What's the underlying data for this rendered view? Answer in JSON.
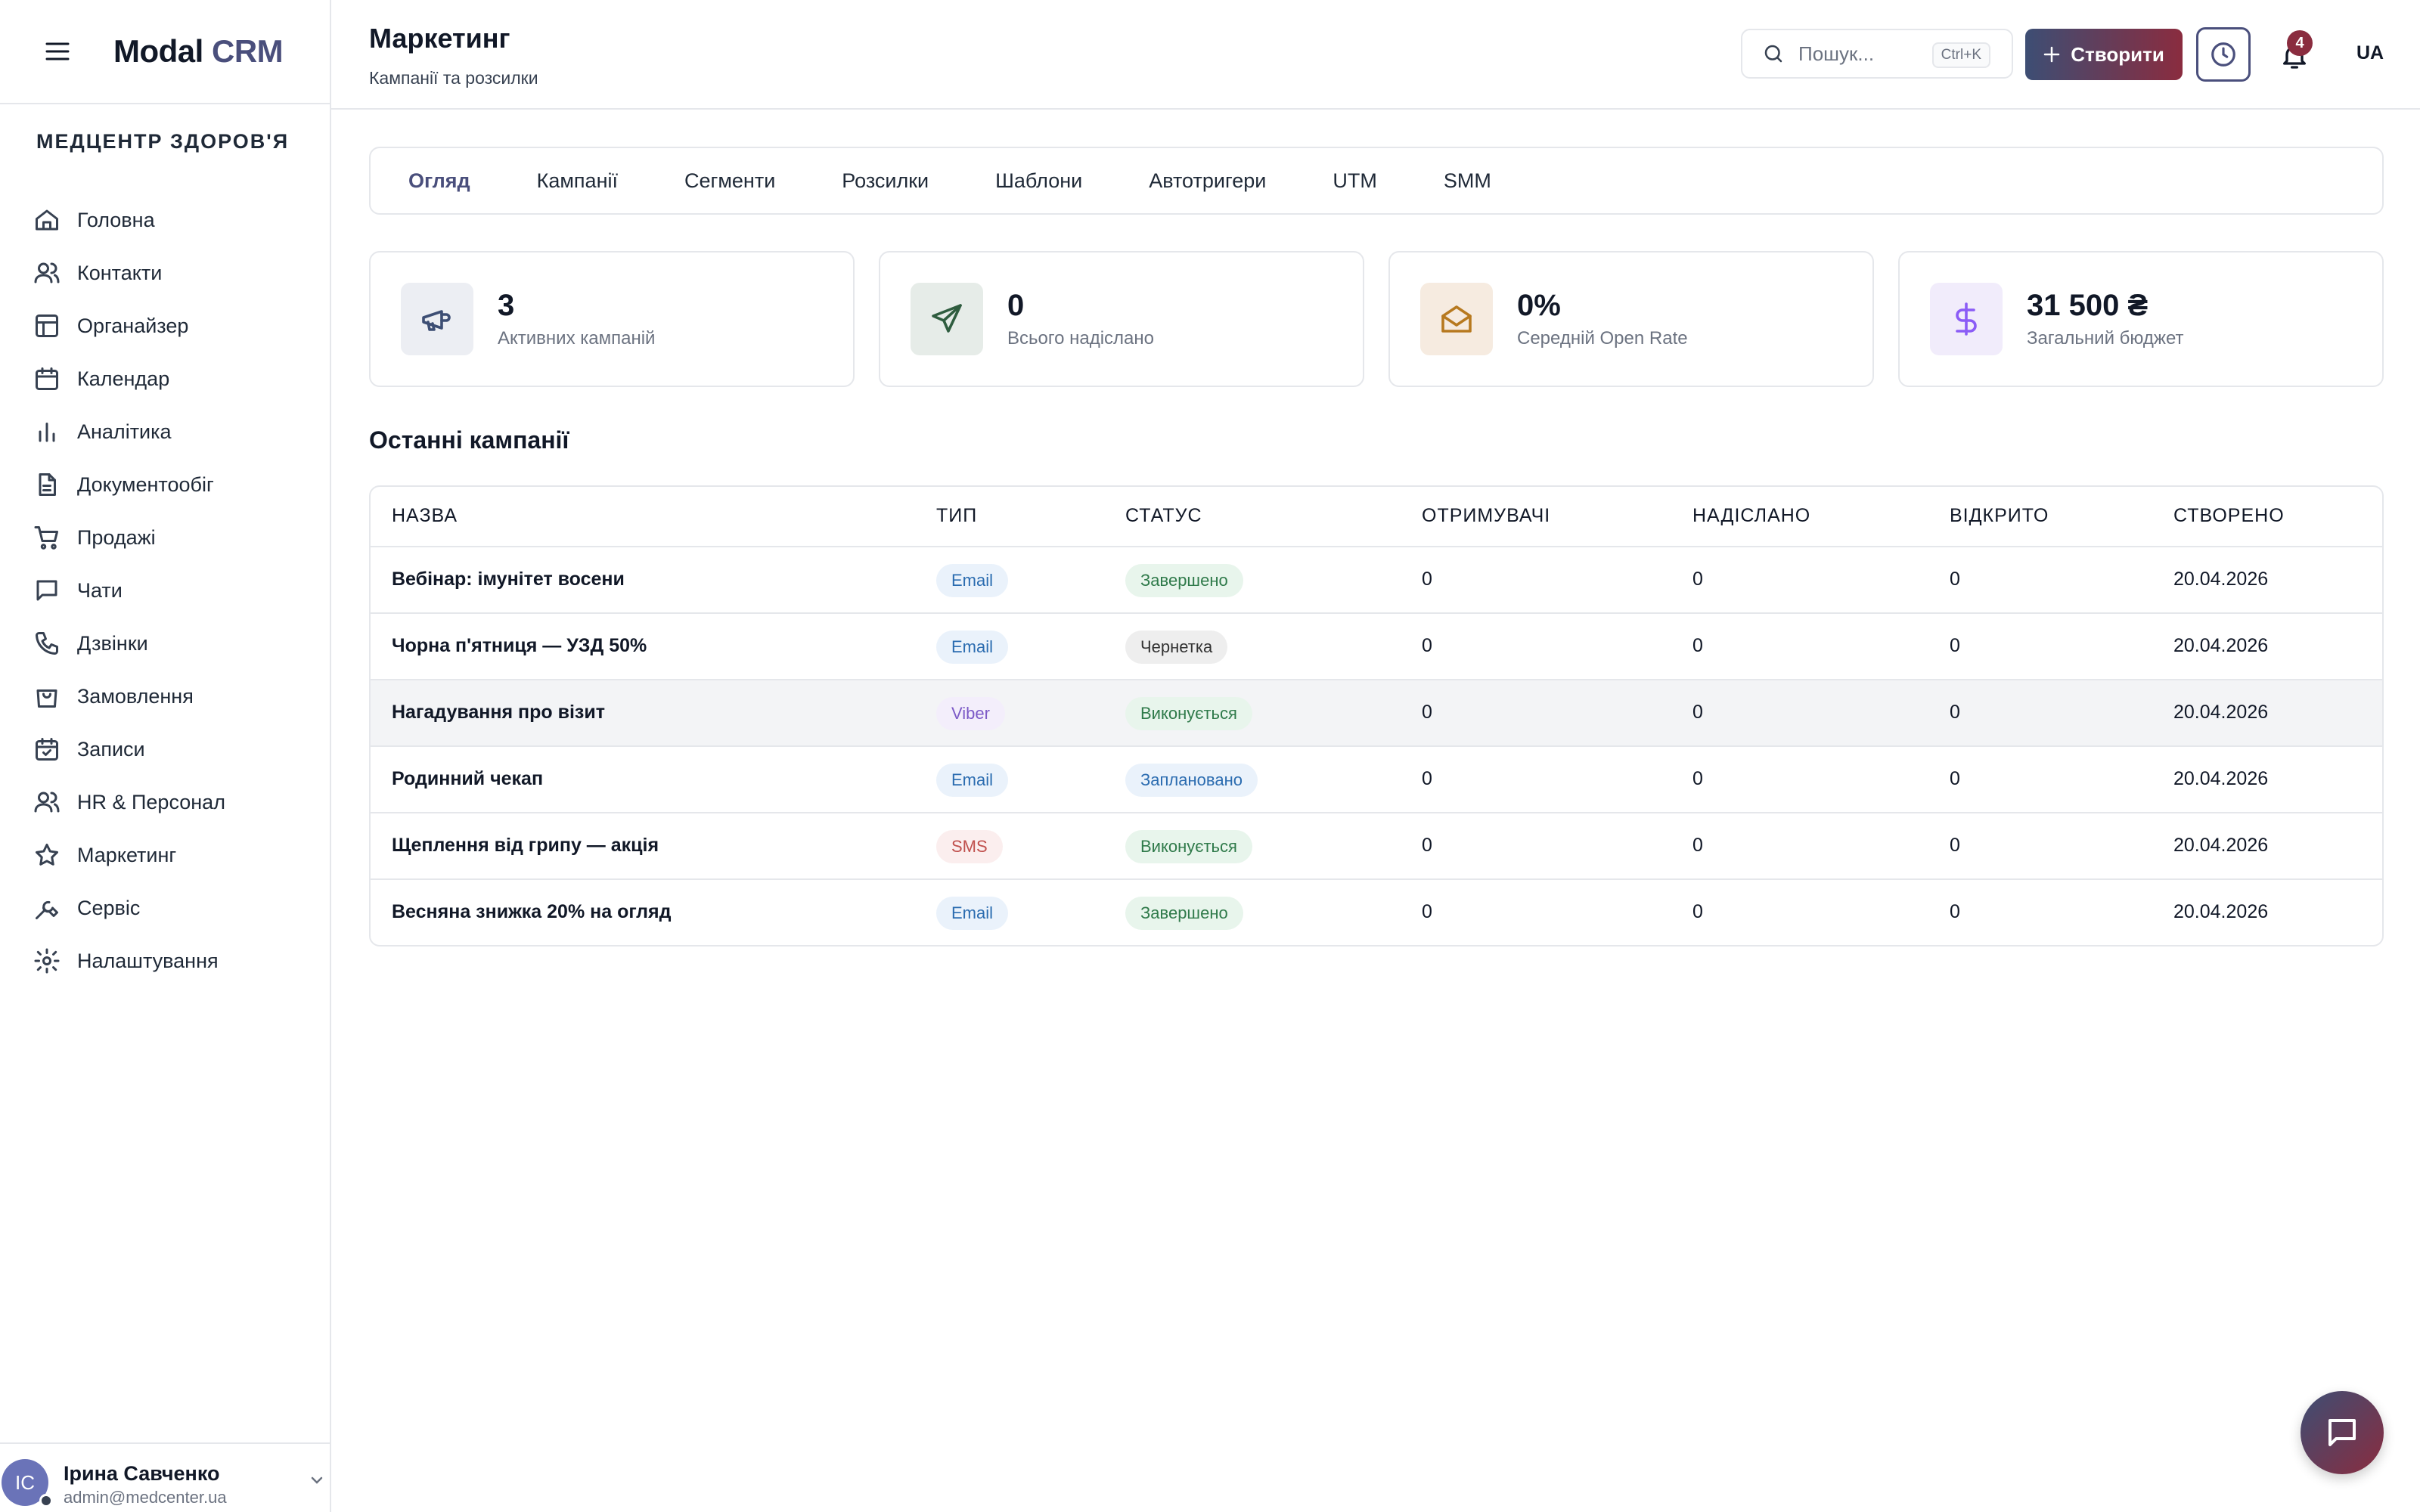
{
  "app": {
    "logo_main": "Modal",
    "logo_accent": "CRM",
    "org_name": "МЕДЦЕНТР ЗДОРОВ'Я"
  },
  "sidebar": {
    "items": [
      {
        "label": "Головна",
        "icon": "home-icon"
      },
      {
        "label": "Контакти",
        "icon": "users-icon"
      },
      {
        "label": "Органайзер",
        "icon": "layout-icon"
      },
      {
        "label": "Календар",
        "icon": "calendar-icon"
      },
      {
        "label": "Аналітика",
        "icon": "bar-chart-icon"
      },
      {
        "label": "Документообіг",
        "icon": "document-icon"
      },
      {
        "label": "Продажі",
        "icon": "cart-icon"
      },
      {
        "label": "Чати",
        "icon": "chat-icon"
      },
      {
        "label": "Дзвінки",
        "icon": "phone-icon"
      },
      {
        "label": "Замовлення",
        "icon": "shopping-bag-icon"
      },
      {
        "label": "Записи",
        "icon": "calendar-check-icon"
      },
      {
        "label": "HR & Персонал",
        "icon": "users-icon"
      },
      {
        "label": "Маркетинг",
        "icon": "star-icon"
      },
      {
        "label": "Сервіс",
        "icon": "wrench-icon"
      },
      {
        "label": "Налаштування",
        "icon": "gear-icon"
      }
    ]
  },
  "user": {
    "initials": "IC",
    "name": "Ірина Савченко",
    "email": "admin@medcenter.ua"
  },
  "header": {
    "title": "Маркетинг",
    "subtitle": "Кампанії та розсилки",
    "search_placeholder": "Пошук...",
    "search_shortcut": "Ctrl+K",
    "create_label": "Створити",
    "notifications_count": "4",
    "language": "UA"
  },
  "tabs": [
    {
      "label": "Огляд",
      "active": true
    },
    {
      "label": "Кампанії"
    },
    {
      "label": "Сегменти"
    },
    {
      "label": "Розсилки"
    },
    {
      "label": "Шаблони"
    },
    {
      "label": "Автотригери"
    },
    {
      "label": "UTM"
    },
    {
      "label": "SMM"
    }
  ],
  "stats": [
    {
      "value": "3",
      "label": "Активних кампаній",
      "icon": "megaphone-icon",
      "bg": "#eceef3",
      "color": "#3d4e74"
    },
    {
      "value": "0",
      "label": "Всього надіслано",
      "icon": "send-icon",
      "bg": "#e6ece8",
      "color": "#2f5d3f"
    },
    {
      "value": "0%",
      "label": "Середній Open Rate",
      "icon": "mail-open-icon",
      "bg": "#f6ebe0",
      "color": "#b7791f"
    },
    {
      "value": "31 500 ₴",
      "label": "Загальний бюджет",
      "icon": "dollar-icon",
      "bg": "#f1ecfb",
      "color": "#8b5cf6"
    }
  ],
  "recent": {
    "title": "Останні кампанії",
    "columns": [
      "НАЗВА",
      "ТИП",
      "СТАТУС",
      "ОТРИМУВАЧІ",
      "НАДІСЛАНО",
      "ВІДКРИТО",
      "СТВОРЕНО"
    ],
    "rows": [
      {
        "name": "Вебінар: імунітет восени",
        "type": "Email",
        "status": "Завершено",
        "recipients": "0",
        "sent": "0",
        "opened": "0",
        "created": "20.04.2026"
      },
      {
        "name": "Чорна п'ятниця — УЗД 50%",
        "type": "Email",
        "status": "Чернетка",
        "recipients": "0",
        "sent": "0",
        "opened": "0",
        "created": "20.04.2026"
      },
      {
        "name": "Нагадування про візит",
        "type": "Viber",
        "status": "Виконується",
        "recipients": "0",
        "sent": "0",
        "opened": "0",
        "created": "20.04.2026"
      },
      {
        "name": "Родинний чекап",
        "type": "Email",
        "status": "Заплановано",
        "recipients": "0",
        "sent": "0",
        "opened": "0",
        "created": "20.04.2026"
      },
      {
        "name": "Щеплення від грипу — акція",
        "type": "SMS",
        "status": "Виконується",
        "recipients": "0",
        "sent": "0",
        "opened": "0",
        "created": "20.04.2026"
      },
      {
        "name": "Весняна знижка 20% на огляд",
        "type": "Email",
        "status": "Завершено",
        "recipients": "0",
        "sent": "0",
        "opened": "0",
        "created": "20.04.2026"
      }
    ]
  },
  "pill_colors": {
    "Email": {
      "bg": "#eaf2fb",
      "fg": "#2b6cb0"
    },
    "Viber": {
      "bg": "#f3eefb",
      "fg": "#7c5ac7"
    },
    "SMS": {
      "bg": "#fbeeee",
      "fg": "#c0504d"
    },
    "Завершено": {
      "bg": "#e8f5ec",
      "fg": "#2f7a4a"
    },
    "Чернетка": {
      "bg": "#eeeeee",
      "fg": "#333333"
    },
    "Виконується": {
      "bg": "#e8f5ec",
      "fg": "#2f7a4a"
    },
    "Заплановано": {
      "bg": "#eaf2fb",
      "fg": "#2b6cb0"
    }
  }
}
